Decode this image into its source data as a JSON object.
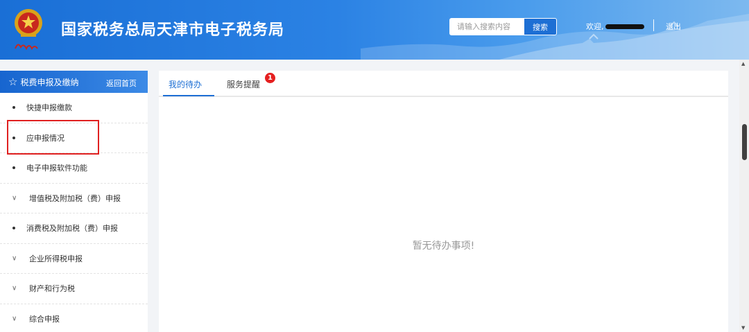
{
  "header": {
    "title": "国家税务总局天津市电子税务局",
    "search_placeholder": "请输入搜索内容",
    "search_button": "搜索",
    "welcome": "欢迎,",
    "logout": "退出"
  },
  "sidebar": {
    "title": "税费申报及缴纳",
    "home_link": "返回首页",
    "items": [
      {
        "label": "快捷申报缴款",
        "marker": "bullet"
      },
      {
        "label": "应申报情况",
        "marker": "bullet"
      },
      {
        "label": "电子申报软件功能",
        "marker": "bullet"
      },
      {
        "label": "增值税及附加税（费）申报",
        "marker": "chevron"
      },
      {
        "label": "消费税及附加税（费）申报",
        "marker": "bullet"
      },
      {
        "label": "企业所得税申报",
        "marker": "chevron"
      },
      {
        "label": "财产和行为税",
        "marker": "chevron"
      },
      {
        "label": "综合申报",
        "marker": "chevron"
      }
    ]
  },
  "main": {
    "tabs": [
      {
        "label": "我的待办",
        "active": true
      },
      {
        "label": "服务提醒",
        "active": false
      }
    ],
    "badge_count": "1",
    "empty_text": "暂无待办事项!"
  },
  "colors": {
    "header_blue": "#1a6fd6",
    "accent": "#1d6fd4",
    "highlight_red": "#e02020",
    "badge_red": "#e52020"
  },
  "icons": {
    "emblem": "tax-emblem-icon",
    "star": "star-icon",
    "chevron": "chevron-down-icon"
  }
}
